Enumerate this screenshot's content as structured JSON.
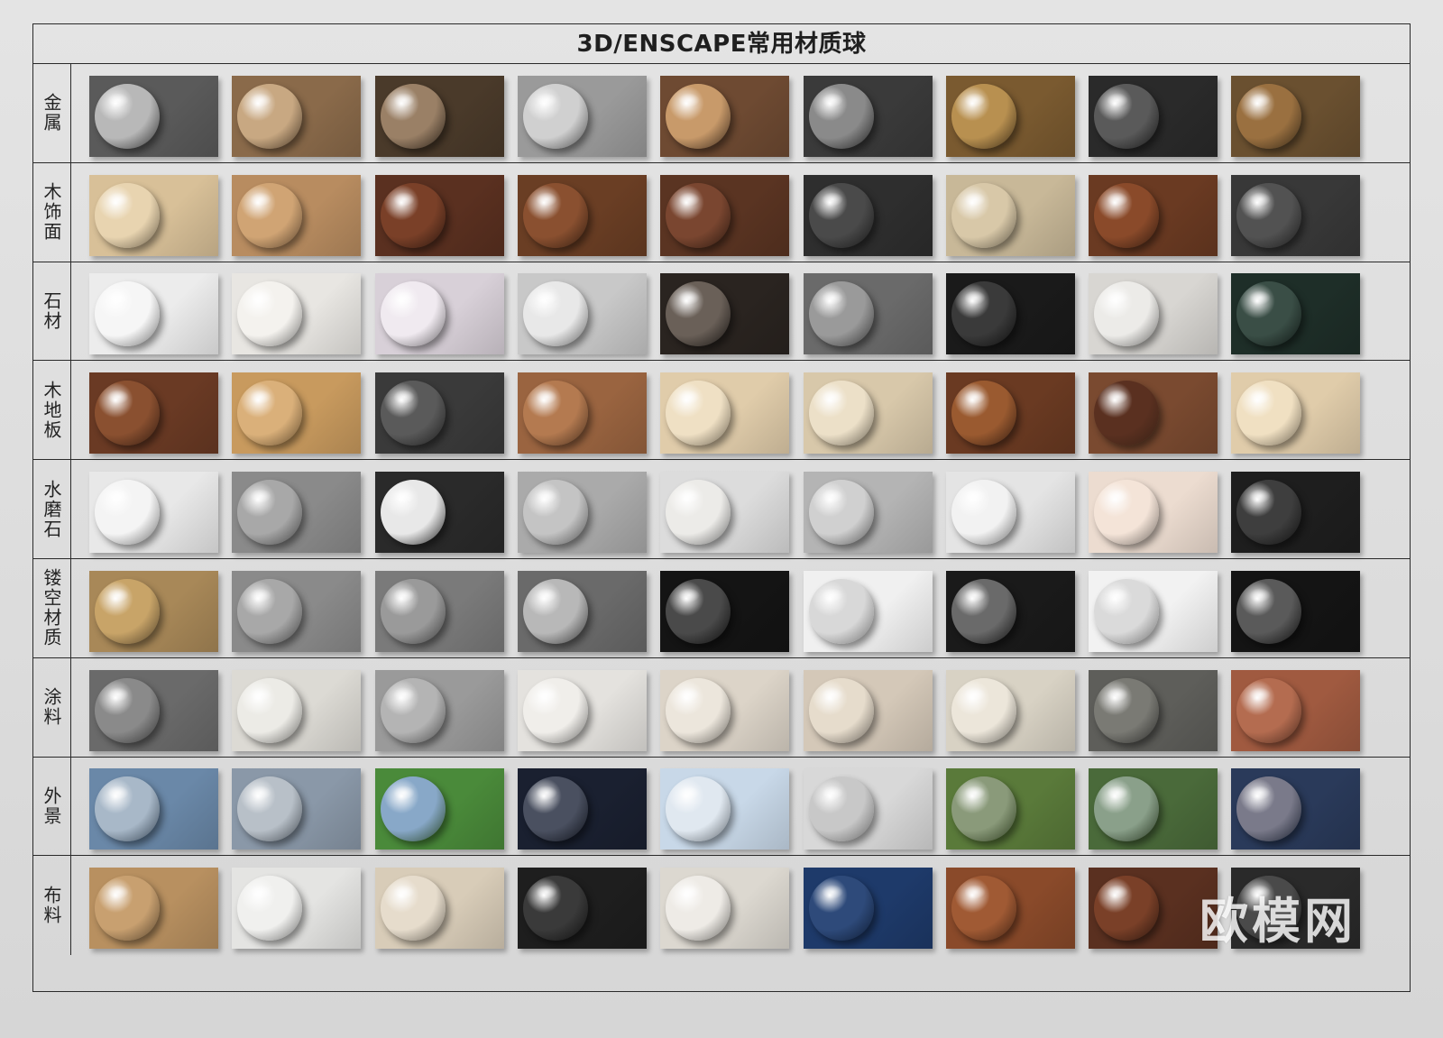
{
  "title": "3D/ENSCAPE常用材质球",
  "watermark": "欧模网",
  "rows": [
    {
      "label": "金属",
      "swatches": [
        {
          "bg": "#5a5a5a",
          "sp": "#b8b8b8"
        },
        {
          "bg": "#8a6a4a",
          "sp": "#c8a882"
        },
        {
          "bg": "#4a3a2a",
          "sp": "#9a8066"
        },
        {
          "bg": "#9a9a9a",
          "sp": "#d0d0d0"
        },
        {
          "bg": "#6e4a32",
          "sp": "#c89a6a"
        },
        {
          "bg": "#3a3a3a",
          "sp": "#8a8a8a"
        },
        {
          "bg": "#7a5a30",
          "sp": "#b89050"
        },
        {
          "bg": "#2a2a2a",
          "sp": "#5a5a5a"
        },
        {
          "bg": "#6a5030",
          "sp": "#9a7040"
        }
      ]
    },
    {
      "label": "木饰面",
      "swatches": [
        {
          "bg": "#d8c098",
          "sp": "#e8d4b0"
        },
        {
          "bg": "#b88c60",
          "sp": "#d0a474"
        },
        {
          "bg": "#5a3020",
          "sp": "#7a4028"
        },
        {
          "bg": "#6a3e24",
          "sp": "#8a5030"
        },
        {
          "bg": "#5a3422",
          "sp": "#7a4630"
        },
        {
          "bg": "#2e2e2e",
          "sp": "#4a4a4a"
        },
        {
          "bg": "#c8b898",
          "sp": "#d8c8a8"
        },
        {
          "bg": "#6a3a22",
          "sp": "#8a4a2a"
        },
        {
          "bg": "#383838",
          "sp": "#525252"
        }
      ]
    },
    {
      "label": "石材",
      "swatches": [
        {
          "bg": "#ececec",
          "sp": "#f6f6f6"
        },
        {
          "bg": "#e8e6e2",
          "sp": "#f4f2ee"
        },
        {
          "bg": "#d8d0d8",
          "sp": "#f0eaf0"
        },
        {
          "bg": "#c8c8c8",
          "sp": "#e8e8e8"
        },
        {
          "bg": "#2a2420",
          "sp": "#6a6058"
        },
        {
          "bg": "#6a6a6a",
          "sp": "#9a9a9a"
        },
        {
          "bg": "#1a1a1a",
          "sp": "#3a3a3a"
        },
        {
          "bg": "#d8d6d2",
          "sp": "#ecebe8"
        },
        {
          "bg": "#1e2e28",
          "sp": "#3a4e46"
        }
      ]
    },
    {
      "label": "木地板",
      "swatches": [
        {
          "bg": "#6a3a24",
          "sp": "#8a5030"
        },
        {
          "bg": "#c89a5e",
          "sp": "#dab07a"
        },
        {
          "bg": "#3a3a3a",
          "sp": "#5a5a5a"
        },
        {
          "bg": "#9a6440",
          "sp": "#b47a50"
        },
        {
          "bg": "#e0ccaa",
          "sp": "#efe0c4"
        },
        {
          "bg": "#d8c8aa",
          "sp": "#ece0c8"
        },
        {
          "bg": "#6a3a22",
          "sp": "#9a5a30"
        },
        {
          "bg": "#7a4a30",
          "sp": "#5a3020"
        },
        {
          "bg": "#e0ccaa",
          "sp": "#f0e0c2"
        }
      ]
    },
    {
      "label": "水磨石",
      "swatches": [
        {
          "bg": "#e8e8e8",
          "sp": "#f4f4f4"
        },
        {
          "bg": "#8a8a8a",
          "sp": "#a8a8a8"
        },
        {
          "bg": "#2a2a2a",
          "sp": "#e8e8e8"
        },
        {
          "bg": "#aaaaaa",
          "sp": "#c4c4c4"
        },
        {
          "bg": "#dcdcdc",
          "sp": "#ecebe8"
        },
        {
          "bg": "#b4b4b4",
          "sp": "#d0d0d0"
        },
        {
          "bg": "#e4e4e4",
          "sp": "#f2f2f2"
        },
        {
          "bg": "#ecdcd0",
          "sp": "#f4e4d8"
        },
        {
          "bg": "#1e1e1e",
          "sp": "#3e3e3e"
        }
      ]
    },
    {
      "label": "镂空材质",
      "swatches": [
        {
          "bg": "#a88858",
          "sp": "#c8a468"
        },
        {
          "bg": "#8a8a8a",
          "sp": "#a8a8a8"
        },
        {
          "bg": "#7a7a7a",
          "sp": "#9a9a9a"
        },
        {
          "bg": "#6a6a6a",
          "sp": "#b8b8b8"
        },
        {
          "bg": "#141414",
          "sp": "#4a4a4a"
        },
        {
          "bg": "#f0f0f0",
          "sp": "#d8d8d8"
        },
        {
          "bg": "#1a1a1a",
          "sp": "#6a6a6a"
        },
        {
          "bg": "#f2f2f2",
          "sp": "#dadada"
        },
        {
          "bg": "#141414",
          "sp": "#5a5a5a"
        }
      ]
    },
    {
      "label": "涂料",
      "swatches": [
        {
          "bg": "#6a6a6a",
          "sp": "#8a8a8a"
        },
        {
          "bg": "#dcdad4",
          "sp": "#ecebe6"
        },
        {
          "bg": "#9a9a9a",
          "sp": "#b4b4b4"
        },
        {
          "bg": "#e4e2de",
          "sp": "#f0eeea"
        },
        {
          "bg": "#dcd4c8",
          "sp": "#ece6dc"
        },
        {
          "bg": "#d4c8b8",
          "sp": "#e6dccc"
        },
        {
          "bg": "#d8d2c4",
          "sp": "#ece6da"
        },
        {
          "bg": "#5e5e5a",
          "sp": "#7a7a74"
        },
        {
          "bg": "#a05a40",
          "sp": "#b46c50"
        }
      ]
    },
    {
      "label": "外景",
      "swatches": [
        {
          "bg": "#6a88a8",
          "sp": "#a8b8c8"
        },
        {
          "bg": "#8a98a8",
          "sp": "#b8c0c8"
        },
        {
          "bg": "#4a8a3a",
          "sp": "#88a8c8"
        },
        {
          "bg": "#1a2030",
          "sp": "#4a5060"
        },
        {
          "bg": "#c8d8e8",
          "sp": "#e0e8f0"
        },
        {
          "bg": "#d8d8d8",
          "sp": "#c8c8c8"
        },
        {
          "bg": "#5a7a3a",
          "sp": "#8a9a7a"
        },
        {
          "bg": "#4a6a3a",
          "sp": "#8aa08a"
        },
        {
          "bg": "#2a3a5a",
          "sp": "#7a7a8a"
        }
      ]
    },
    {
      "label": "布料",
      "swatches": [
        {
          "bg": "#b89060",
          "sp": "#c8a070"
        },
        {
          "bg": "#e4e4e2",
          "sp": "#f0f0ee"
        },
        {
          "bg": "#d8ccb8",
          "sp": "#e6dccc"
        },
        {
          "bg": "#1e1e1e",
          "sp": "#3a3a3a"
        },
        {
          "bg": "#dcd8d0",
          "sp": "#eeebe6"
        },
        {
          "bg": "#1e3a6a",
          "sp": "#2e4a7a"
        },
        {
          "bg": "#8a4a2a",
          "sp": "#a05a34"
        },
        {
          "bg": "#5a3020",
          "sp": "#7a4028"
        },
        {
          "bg": "#2a2a2a",
          "sp": "#4a4a4a"
        }
      ]
    }
  ]
}
